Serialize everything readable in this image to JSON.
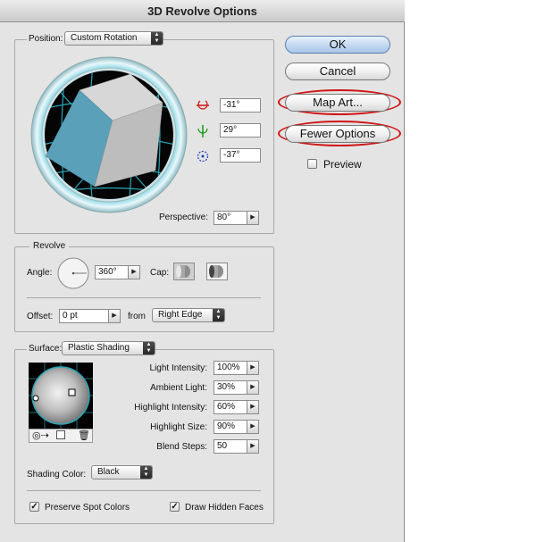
{
  "title": "3D Revolve Options",
  "position": {
    "label": "Position:",
    "preset": "Custom Rotation",
    "rot_x": "-31°",
    "rot_y": "29°",
    "rot_z": "-37°",
    "perspective_label": "Perspective:",
    "perspective": "80°"
  },
  "revolve": {
    "legend": "Revolve",
    "angle_label": "Angle:",
    "angle": "360°",
    "cap_label": "Cap:",
    "offset_label": "Offset:",
    "offset": "0 pt",
    "from_label": "from",
    "from": "Right Edge"
  },
  "surface": {
    "label": "Surface:",
    "type": "Plastic Shading",
    "rows": [
      {
        "label": "Light Intensity:",
        "value": "100%"
      },
      {
        "label": "Ambient Light:",
        "value": "30%"
      },
      {
        "label": "Highlight Intensity:",
        "value": "60%"
      },
      {
        "label": "Highlight Size:",
        "value": "90%"
      },
      {
        "label": "Blend Steps:",
        "value": "50"
      }
    ],
    "shading_color_label": "Shading Color:",
    "shading_color": "Black"
  },
  "checkboxes": {
    "preserve_spot": "Preserve Spot Colors",
    "preserve_spot_checked": true,
    "draw_hidden": "Draw Hidden Faces",
    "draw_hidden_checked": true,
    "preview": "Preview",
    "preview_checked": false
  },
  "buttons": {
    "ok": "OK",
    "cancel": "Cancel",
    "map_art": "Map Art...",
    "fewer_options": "Fewer Options"
  },
  "colors": {
    "dialog_bg": "#e4e4e4",
    "cube_front": "#5aa0b8",
    "annotation_ring": "#d01515",
    "track_grid": "#2aa6b8"
  }
}
